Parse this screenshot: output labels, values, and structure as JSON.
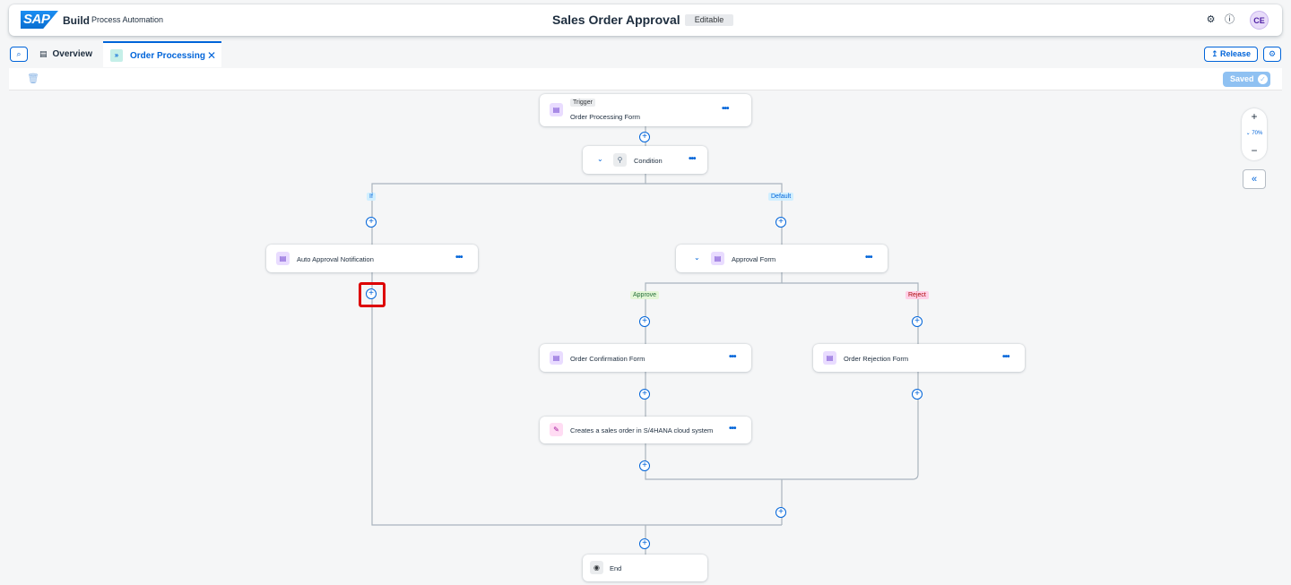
{
  "shell": {
    "brand": "Build",
    "product": "Process Automation",
    "title": "Sales Order Approval",
    "status": "Editable",
    "avatar_initials": "CE",
    "logo_text": "SAP"
  },
  "tabs": {
    "overview": "Overview",
    "order_processing": "Order Processing",
    "release": "Release"
  },
  "toolbar": {
    "saved": "Saved"
  },
  "zoom": {
    "level": "70%"
  },
  "nodes": {
    "trigger_tag": "Trigger",
    "trigger_label": "Order Processing Form",
    "condition": "Condition",
    "auto_approval": "Auto Approval Notification",
    "approval_form": "Approval Form",
    "order_confirmation": "Order Confirmation Form",
    "order_rejection": "Order Rejection Form",
    "sales_order": "Creates a sales order in S/4HANA cloud system",
    "end": "End"
  },
  "branches": {
    "if": "If",
    "default": "Default",
    "approve": "Approve",
    "reject": "Reject"
  },
  "colors": {
    "accent": "#0064d9",
    "highlight": "#dd0000"
  }
}
